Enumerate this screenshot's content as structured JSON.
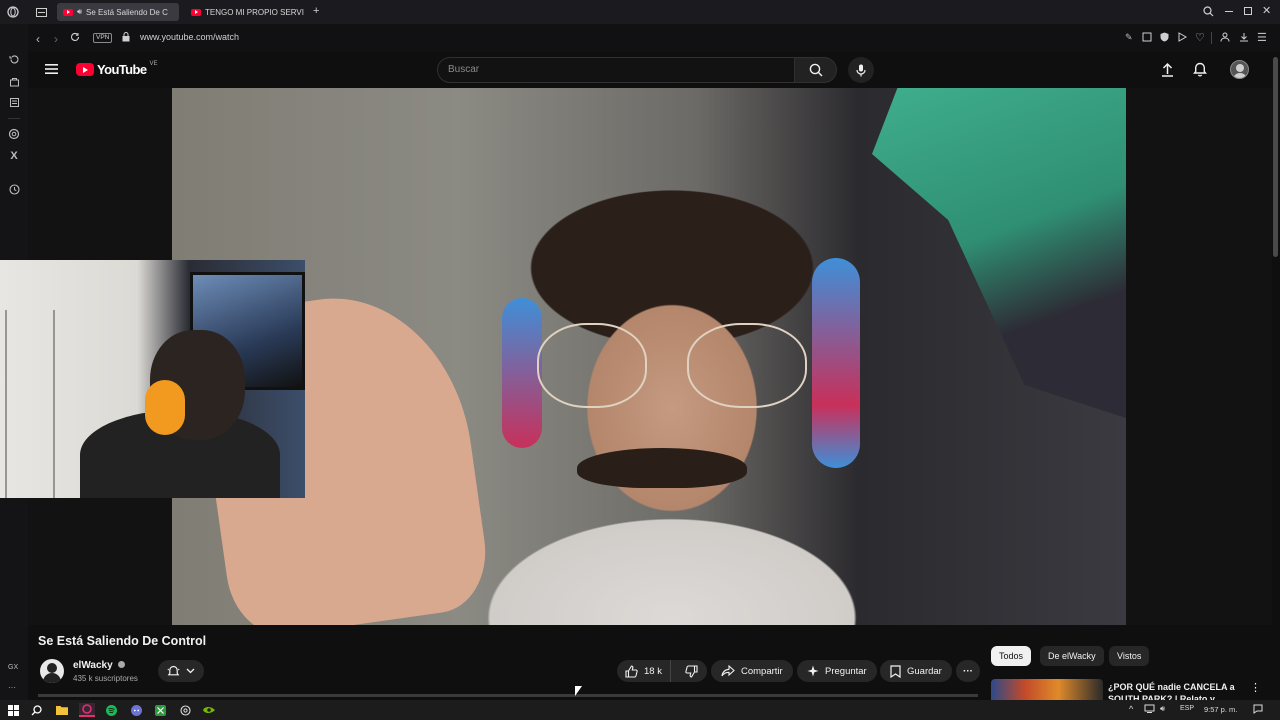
{
  "browser": {
    "tabs": [
      {
        "label": "Se Está Saliendo De C",
        "active": true,
        "audio": true
      },
      {
        "label": "TENGO MI PROPIO SERVI",
        "active": false,
        "audio": false
      }
    ],
    "new_tab": "+",
    "vpn_label": "VPN",
    "url": "www.youtube.com/watch",
    "sidebar_gx": "GX",
    "sidebar_more": "···"
  },
  "youtube": {
    "logo_text": "YouTube",
    "country": "VE",
    "search_placeholder": "Buscar"
  },
  "video": {
    "title": "Se Está Saliendo De Control",
    "channel": "elWacky",
    "subscribers": "435 k suscriptores",
    "likes": "18 k",
    "share_label": "Compartir",
    "ask_label": "Preguntar",
    "save_label": "Guardar",
    "more_label": "···"
  },
  "chips": [
    {
      "label": "Todos",
      "active": true
    },
    {
      "label": "De elWacky",
      "active": false
    },
    {
      "label": "Vistos",
      "active": false
    }
  ],
  "recommended": {
    "title": "¿POR QUÉ nadie CANCELA a SOUTH PARK? | Relato y"
  },
  "taskbar": {
    "lang": "ESP",
    "time": "9:57 p. m."
  },
  "colors": {
    "youtube_red": "#ff0033",
    "background": "#0f0f0f",
    "pill": "#272727"
  }
}
